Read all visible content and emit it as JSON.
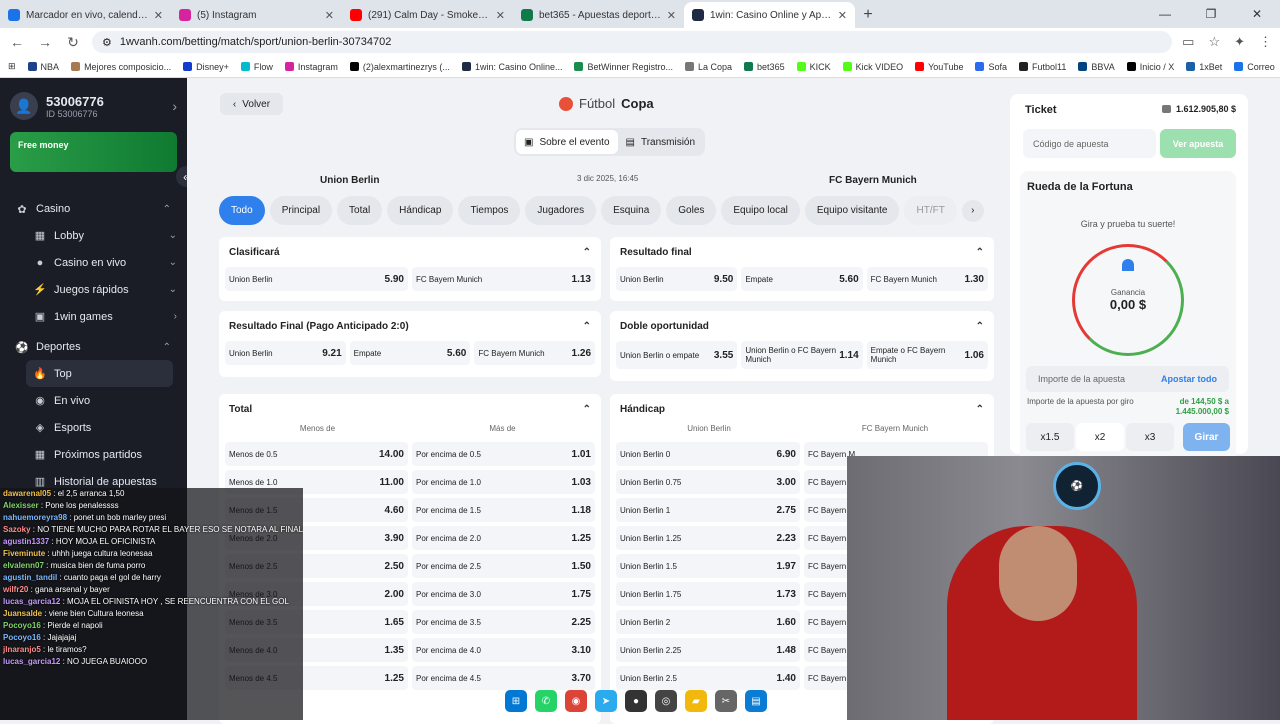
{
  "tabs": [
    {
      "label": "Marcador en vivo, calendario y",
      "color": "#1a73e8"
    },
    {
      "label": "(5) Instagram",
      "color": "#d6249f"
    },
    {
      "label": "(291) Calm Day - Smoke an",
      "color": "#ff0000"
    },
    {
      "label": "bet365 - Apuestas deportivas e",
      "color": "#117a4c"
    },
    {
      "label": "1win: Casino Online y Apuestas",
      "color": "#1f2a44"
    }
  ],
  "browser": {
    "url": "1wvanh.com/betting/match/sport/union-berlin-30734702"
  },
  "bookmarks": [
    {
      "label": "NBA",
      "color": "#1d428a"
    },
    {
      "label": "Mejores composicio...",
      "color": "#a57c52"
    },
    {
      "label": "Disney+",
      "color": "#113ccf"
    },
    {
      "label": "Flow",
      "color": "#0bc"
    },
    {
      "label": "Instagram",
      "color": "#d6249f"
    },
    {
      "label": "(2)alexmartinezrys (...",
      "color": "#000"
    },
    {
      "label": "1win: Casino Online...",
      "color": "#1f2a44"
    },
    {
      "label": "BetWinner Registro...",
      "color": "#1a8c4e"
    },
    {
      "label": "La Copa",
      "color": "#777"
    },
    {
      "label": "bet365",
      "color": "#117a4c"
    },
    {
      "label": "KICK",
      "color": "#53fc18"
    },
    {
      "label": "Kick VIDEO",
      "color": "#53fc18"
    },
    {
      "label": "YouTube",
      "color": "#ff0000"
    },
    {
      "label": "Sofa",
      "color": "#2c6bed"
    },
    {
      "label": "Futbol11",
      "color": "#222"
    },
    {
      "label": "BBVA",
      "color": "#004481"
    },
    {
      "label": "Inicio / X",
      "color": "#000"
    },
    {
      "label": "1xBet",
      "color": "#1a5fa8"
    },
    {
      "label": "Correo",
      "color": "#1a73e8"
    }
  ],
  "sidebar": {
    "account": "53006776",
    "account_id": "ID 53006776",
    "promo": "Free money",
    "casino": "Casino",
    "casino_items": [
      "Lobby",
      "Casino en vivo",
      "Juegos rápidos",
      "1win games"
    ],
    "sports": "Deportes",
    "sports_items": [
      "Top",
      "En vivo",
      "Esports",
      "Próximos partidos",
      "Historial de apuestas"
    ]
  },
  "match": {
    "back": "Volver",
    "sport": "Fútbol",
    "competition": "Copa",
    "tab_event": "Sobre el evento",
    "tab_stream": "Transmisión",
    "home": "Union Berlin",
    "away": "FC Bayern Munich",
    "date": "3 dic 2025, 16:45",
    "filters": [
      "Todo",
      "Principal",
      "Total",
      "Hándicap",
      "Tiempos",
      "Jugadores",
      "Esquina",
      "Goles",
      "Equipo local",
      "Equipo visitante",
      "HT/FT"
    ]
  },
  "markets": {
    "clasificara": {
      "title": "Clasificará",
      "odds": [
        [
          "Union Berlin",
          "5.90"
        ],
        [
          "FC Bayern Munich",
          "1.13"
        ]
      ]
    },
    "resultado_final": {
      "title": "Resultado final",
      "odds": [
        [
          "Union Berlin",
          "9.50"
        ],
        [
          "Empate",
          "5.60"
        ],
        [
          "FC Bayern Munich",
          "1.30"
        ]
      ]
    },
    "pago_anticipado": {
      "title": "Resultado Final (Pago Anticipado 2:0)",
      "odds": [
        [
          "Union Berlin",
          "9.21"
        ],
        [
          "Empate",
          "5.60"
        ],
        [
          "FC Bayern Munich",
          "1.26"
        ]
      ]
    },
    "doble": {
      "title": "Doble oportunidad",
      "odds": [
        [
          "Union Berlin o empate",
          "3.55"
        ],
        [
          "Union Berlin o FC Bayern Munich",
          "1.14"
        ],
        [
          "Empate o FC Bayern Munich",
          "1.06"
        ]
      ]
    },
    "total": {
      "title": "Total",
      "col1": "Menos de",
      "col2": "Más de",
      "rows": [
        [
          "Menos de 0.5",
          "14.00",
          "Por encima de 0.5",
          "1.01"
        ],
        [
          "Menos de 1.0",
          "11.00",
          "Por encima de 1.0",
          "1.03"
        ],
        [
          "Menos de 1.5",
          "4.60",
          "Por encima de 1.5",
          "1.18"
        ],
        [
          "Menos de 2.0",
          "3.90",
          "Por encima de 2.0",
          "1.25"
        ],
        [
          "Menos de 2.5",
          "2.50",
          "Por encima de 2.5",
          "1.50"
        ],
        [
          "Menos de 3.0",
          "2.00",
          "Por encima de 3.0",
          "1.75"
        ],
        [
          "Menos de 3.5",
          "1.65",
          "Por encima de 3.5",
          "2.25"
        ],
        [
          "Menos de 4.0",
          "1.35",
          "Por encima de 4.0",
          "3.10"
        ],
        [
          "Menos de 4.5",
          "1.25",
          "Por encima de 4.5",
          "3.70"
        ]
      ]
    },
    "handicap": {
      "title": "Hándicap",
      "col1": "Union Berlin",
      "col2": "FC Bayern Munich",
      "rows": [
        [
          "Union Berlin 0",
          "6.90",
          "FC Bayern M"
        ],
        [
          "Union Berlin 0.75",
          "3.00",
          "FC Bayern M"
        ],
        [
          "Union Berlin 1",
          "2.75",
          "FC Bayern M"
        ],
        [
          "Union Berlin 1.25",
          "2.23",
          "FC Bayern M"
        ],
        [
          "Union Berlin 1.5",
          "1.97",
          "FC Bayern M"
        ],
        [
          "Union Berlin 1.75",
          "1.73",
          "FC Bayern M"
        ],
        [
          "Union Berlin 2",
          "1.60",
          "FC Bayern M"
        ],
        [
          "Union Berlin 2.25",
          "1.48",
          "FC Bayern M"
        ],
        [
          "Union Berlin 2.5",
          "1.40",
          "FC Bayern M"
        ]
      ]
    }
  },
  "ticket": {
    "title": "Ticket",
    "balance": "1.612.905,80 $",
    "code_placeholder": "Código de apuesta",
    "view": "Ver apuesta",
    "wheel_title": "Rueda de la Fortuna",
    "wheel_sub": "Gira y prueba tu suerte!",
    "gain_label": "Ganancia",
    "gain_value": "0,00 $",
    "stake_placeholder": "Importe de la apuesta",
    "all_in": "Apostar todo",
    "range_label": "Importe de la apuesta por giro",
    "range_value": "de 144,50 $ a 1.445.000,00 $",
    "multipliers": [
      "x1.5",
      "x2",
      "x3"
    ],
    "spin": "Girar"
  },
  "chat": [
    [
      "dawarenal05",
      "el 2,5 arranca 1,50"
    ],
    [
      "Alexisser",
      "Pone los penalessss"
    ],
    [
      "nahuemoreyra98",
      "ponet un bob marley presi"
    ],
    [
      "Sazoky",
      "NO TIENE MUCHO PARA ROTAR EL BAYER ESO SE NOTARA AL FINAL PRESI?"
    ],
    [
      "agustin1337",
      "HOY MOJA EL OFICINISTA"
    ],
    [
      "Fiveminute",
      "uhhh juega cultura leonesaa"
    ],
    [
      "elvalenn07",
      "musica bien de fuma porro"
    ],
    [
      "agustin_tandil",
      "cuanto paga el gol de harry"
    ],
    [
      "wilfr20",
      "gana arsenal y bayer"
    ],
    [
      "lucas_garcia12",
      "MOJA EL OFINISTA HOY , SE REENCUENTRA CON EL GOL"
    ],
    [
      "Juansalde",
      "viene bien Cultura leonesa"
    ],
    [
      "Pocoyo16",
      "Pierde el napoli"
    ],
    [
      "Pocoyo16",
      "Jajajajaj"
    ],
    [
      "jlnaranjo5",
      "le tiramos?"
    ],
    [
      "lucas_garcia12",
      "NO JUEGA BUAIOOO"
    ]
  ]
}
